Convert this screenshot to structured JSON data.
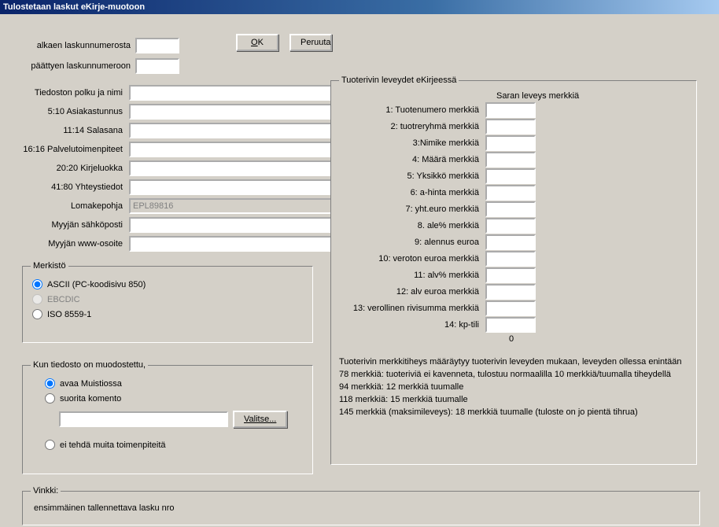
{
  "window": {
    "title": "Tulostetaan laskut eKirje-muotoon"
  },
  "top": {
    "from_label": "alkaen laskunnumerosta",
    "to_label": "päättyen laskunnumeroon",
    "ok": "OK",
    "ok_accel": "O",
    "cancel": "Peruuta"
  },
  "fields": {
    "path_label": "Tiedoston polku ja nimi",
    "cust_label": "5:10 Asiakastunnus",
    "pass_label": "11:14 Salasana",
    "service_label": "16:16 Palvelutoimenpiteet",
    "letterclass_label": "20:20  Kirjeluokka",
    "contact_label": "41:80 Yhteystiedot",
    "template_label": "Lomakepohja",
    "template_value": "EPL89816",
    "email_label": "Myyjän sähköposti",
    "www_label": "Myyjän www-osoite"
  },
  "merkisto": {
    "legend": "Merkistö",
    "ascii": "ASCII (PC-koodisivu 850)",
    "ebcdic": "EBCDIC",
    "iso": "ISO 8559-1"
  },
  "kun": {
    "legend": "Kun tiedosto on muodostettu,",
    "open": "avaa Muistiossa",
    "run": "suorita komento",
    "none": "ei tehdä muita toimenpiteitä",
    "browse": "Valitse..."
  },
  "cols": {
    "legend": "Tuoterivin leveydet eKirjeessä",
    "header": "Saran leveys merkkiä",
    "c1": "1: Tuotenumero merkkiä",
    "c2": "2: tuotreryhmä merkkiä",
    "c3": "3:Nimike merkkiä",
    "c4": "4: Määrä merkkiä",
    "c5": "5: Yksikkö merkkiä",
    "c6": "6: a-hinta  merkkiä",
    "c7": "7: yht.euro merkkiä",
    "c8": "8. ale% merkkiä",
    "c9": "9: alennus euroa",
    "c10": "10: veroton euroa merkkiä",
    "c11": "11: alv% merkkiä",
    "c12": "12: alv euroa merkkiä",
    "c13": "13: verollinen rivisumma merkkiä",
    "c14": "14: kp-tili",
    "total": "0",
    "help1": "Tuoterivin merkkitiheys määräytyy tuoterivin leveyden mukaan, leveyden ollessa enintään",
    "help2": "78 merkkiä: tuoteriviä ei kavenneta, tulostuu normaalilla 10 merkkiä/tuumalla tiheydellä",
    "help3": "94 merkkiä: 12 merkkiä tuumalle",
    "help4": "118 merkkiä: 15 merkkiä tuumalle",
    "help5": "145 merkkiä (maksimileveys): 18 merkkiä tuumalle (tuloste on jo pientä tihrua)"
  },
  "vinkki": {
    "legend": "Vinkki:",
    "text": "ensimmäinen tallennettava lasku nro"
  }
}
